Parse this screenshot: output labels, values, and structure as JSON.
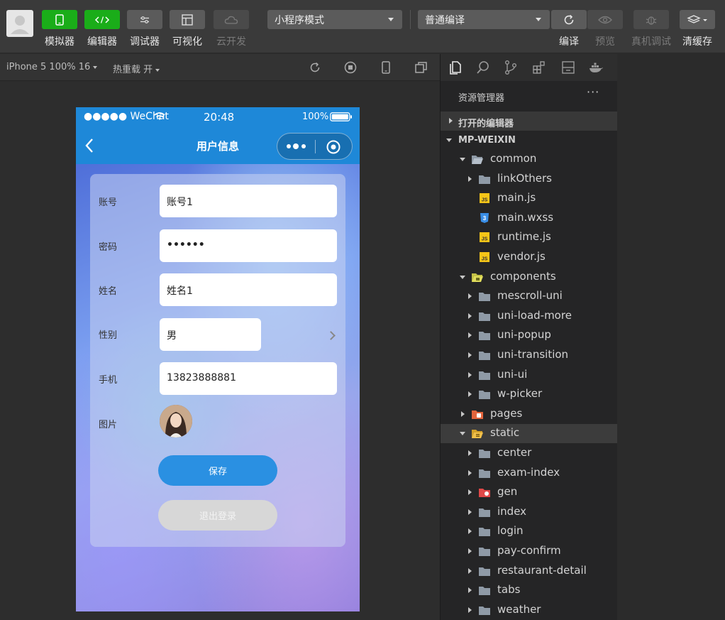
{
  "toolbar": {
    "buttons": [
      {
        "label": "模拟器",
        "icon": "phone-icon"
      },
      {
        "label": "编辑器",
        "icon": "code-icon"
      },
      {
        "label": "调试器",
        "icon": "debug-icon"
      },
      {
        "label": "可视化",
        "icon": "layout-icon"
      },
      {
        "label": "云开发",
        "icon": "cloud-icon"
      }
    ],
    "mode_select": "小程序模式",
    "compile_select": "普通编译",
    "actions": [
      {
        "label": "编译",
        "icon": "refresh-icon"
      },
      {
        "label": "预览",
        "icon": "eye-icon"
      },
      {
        "label": "真机调试",
        "icon": "bug-icon"
      },
      {
        "label": "清缓存",
        "icon": "layers-icon"
      }
    ]
  },
  "subbar": {
    "device": "iPhone 5 100% 16",
    "hot_reload": "热重载 开"
  },
  "phone": {
    "status": {
      "carrier": "●●●●● WeChat",
      "time": "20:48",
      "battery": "100%"
    },
    "nav_title": "用户信息",
    "fields": [
      {
        "label": "账号",
        "value": "账号1"
      },
      {
        "label": "密码",
        "value": "••••••"
      },
      {
        "label": "姓名",
        "value": "姓名1"
      },
      {
        "label": "性别",
        "value": "男"
      },
      {
        "label": "手机",
        "value": "13823888881"
      },
      {
        "label": "图片"
      }
    ],
    "save_label": "保存",
    "logout_label": "退出登录"
  },
  "explorer": {
    "title": "资源管理器",
    "more": "···",
    "open_editors": "打开的编辑器",
    "project": "MP-WEIXIN",
    "tree": [
      {
        "label": "common",
        "type": "folder-open",
        "depth": 1,
        "expanded": true
      },
      {
        "label": "linkOthers",
        "type": "folder",
        "depth": 2
      },
      {
        "label": "main.js",
        "type": "js",
        "depth": 2
      },
      {
        "label": "main.wxss",
        "type": "css",
        "depth": 2
      },
      {
        "label": "runtime.js",
        "type": "js",
        "depth": 2
      },
      {
        "label": "vendor.js",
        "type": "js",
        "depth": 2
      },
      {
        "label": "components",
        "type": "folder-open-special",
        "depth": 1,
        "expanded": true
      },
      {
        "label": "mescroll-uni",
        "type": "folder",
        "depth": 2
      },
      {
        "label": "uni-load-more",
        "type": "folder",
        "depth": 2
      },
      {
        "label": "uni-popup",
        "type": "folder",
        "depth": 2
      },
      {
        "label": "uni-transition",
        "type": "folder",
        "depth": 2
      },
      {
        "label": "uni-ui",
        "type": "folder",
        "depth": 2
      },
      {
        "label": "w-picker",
        "type": "folder",
        "depth": 2
      },
      {
        "label": "pages",
        "type": "folder-pages",
        "depth": 1
      },
      {
        "label": "static",
        "type": "folder-open-static",
        "depth": 1,
        "expanded": true,
        "selected": true
      },
      {
        "label": "center",
        "type": "folder",
        "depth": 2
      },
      {
        "label": "exam-index",
        "type": "folder",
        "depth": 2
      },
      {
        "label": "gen",
        "type": "folder-red",
        "depth": 2
      },
      {
        "label": "index",
        "type": "folder",
        "depth": 2
      },
      {
        "label": "login",
        "type": "folder",
        "depth": 2
      },
      {
        "label": "pay-confirm",
        "type": "folder",
        "depth": 2
      },
      {
        "label": "restaurant-detail",
        "type": "folder",
        "depth": 2
      },
      {
        "label": "tabs",
        "type": "folder",
        "depth": 2
      },
      {
        "label": "weather",
        "type": "folder",
        "depth": 2
      }
    ]
  },
  "colors": {
    "wechat_green": "#1aad19",
    "nav_blue": "#1e88d8",
    "save_blue": "#2a90e2"
  }
}
